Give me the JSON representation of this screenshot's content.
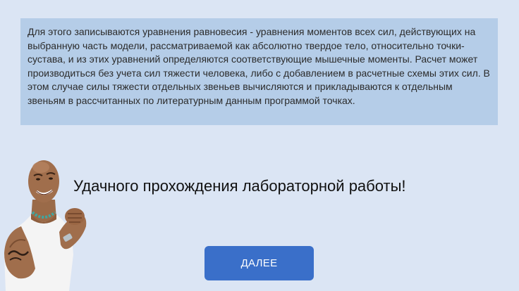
{
  "info": {
    "text": "Для этого записываются уравнения равновесия - уравнения моментов всех сил, действующих на выбранную часть модели, рассматриваемой как абсолютно твердое тело, относительно точки-сустава, и из этих уравнений определяются соответствующие мышечные моменты. Расчет может производиться без учета сил тяжести человека, либо с добавлением в расчетные схемы этих сил. В этом случае силы тяжести отдельных звеньев вычисляются и прикладываются к отдельным звеньям в рассчитанных по литературным данным программой точках."
  },
  "greeting": {
    "text": "Удачного прохождения лабораторной работы!"
  },
  "buttons": {
    "next_label": "ДАЛЕЕ"
  },
  "colors": {
    "background": "#dbe5f4",
    "info_box": "#b5cde8",
    "button": "#3a6fc9"
  }
}
